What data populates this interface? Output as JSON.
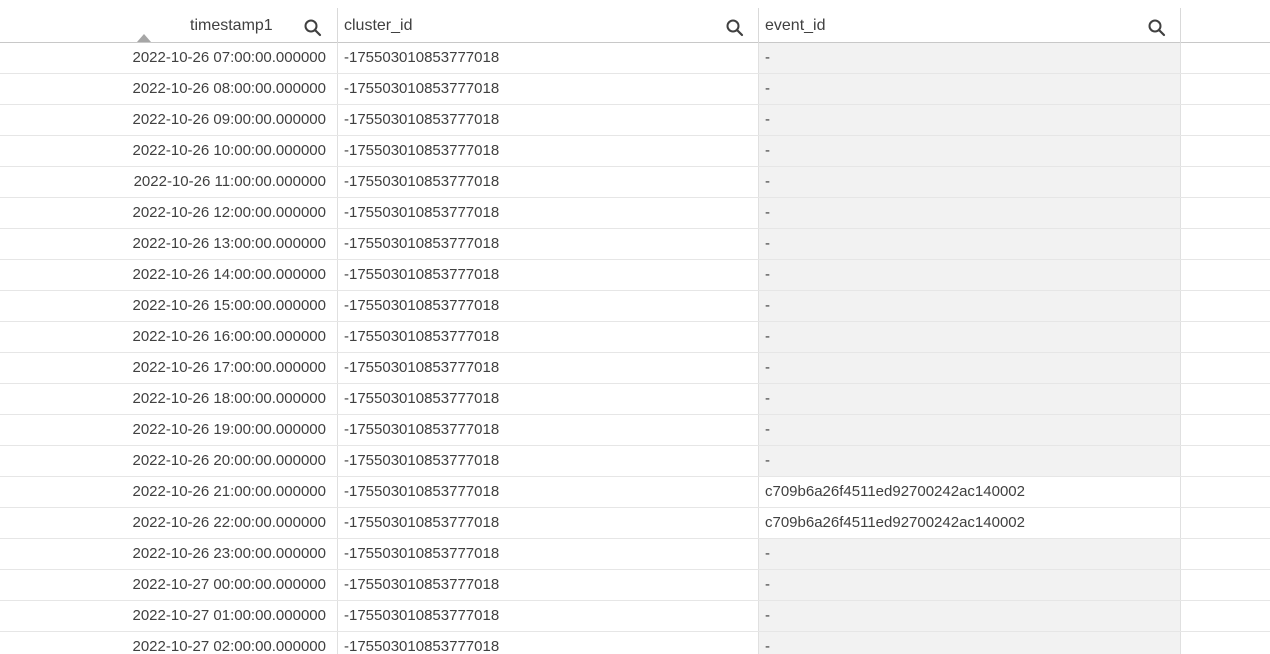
{
  "columns": [
    {
      "key": "timestamp1",
      "label": "timestamp1",
      "sorted": "ascending"
    },
    {
      "key": "cluster_id",
      "label": "cluster_id"
    },
    {
      "key": "event_id",
      "label": "event_id"
    }
  ],
  "icons": {
    "column_search": "search-icon",
    "sort": "sort-ascending-icon"
  },
  "colors": {
    "null_cell_background": "#f2f2f2",
    "grid_line": "#e6e6e6",
    "text": "#404040"
  },
  "rows": [
    {
      "timestamp1": "2022-10-26 07:00:00.000000",
      "cluster_id": "-175503010853777018",
      "event_id": "-"
    },
    {
      "timestamp1": "2022-10-26 08:00:00.000000",
      "cluster_id": "-175503010853777018",
      "event_id": "-"
    },
    {
      "timestamp1": "2022-10-26 09:00:00.000000",
      "cluster_id": "-175503010853777018",
      "event_id": "-"
    },
    {
      "timestamp1": "2022-10-26 10:00:00.000000",
      "cluster_id": "-175503010853777018",
      "event_id": "-"
    },
    {
      "timestamp1": "2022-10-26 11:00:00.000000",
      "cluster_id": "-175503010853777018",
      "event_id": "-"
    },
    {
      "timestamp1": "2022-10-26 12:00:00.000000",
      "cluster_id": "-175503010853777018",
      "event_id": "-"
    },
    {
      "timestamp1": "2022-10-26 13:00:00.000000",
      "cluster_id": "-175503010853777018",
      "event_id": "-"
    },
    {
      "timestamp1": "2022-10-26 14:00:00.000000",
      "cluster_id": "-175503010853777018",
      "event_id": "-"
    },
    {
      "timestamp1": "2022-10-26 15:00:00.000000",
      "cluster_id": "-175503010853777018",
      "event_id": "-"
    },
    {
      "timestamp1": "2022-10-26 16:00:00.000000",
      "cluster_id": "-175503010853777018",
      "event_id": "-"
    },
    {
      "timestamp1": "2022-10-26 17:00:00.000000",
      "cluster_id": "-175503010853777018",
      "event_id": "-"
    },
    {
      "timestamp1": "2022-10-26 18:00:00.000000",
      "cluster_id": "-175503010853777018",
      "event_id": "-"
    },
    {
      "timestamp1": "2022-10-26 19:00:00.000000",
      "cluster_id": "-175503010853777018",
      "event_id": "-"
    },
    {
      "timestamp1": "2022-10-26 20:00:00.000000",
      "cluster_id": "-175503010853777018",
      "event_id": "-"
    },
    {
      "timestamp1": "2022-10-26 21:00:00.000000",
      "cluster_id": "-175503010853777018",
      "event_id": "c709b6a26f4511ed92700242ac140002"
    },
    {
      "timestamp1": "2022-10-26 22:00:00.000000",
      "cluster_id": "-175503010853777018",
      "event_id": "c709b6a26f4511ed92700242ac140002"
    },
    {
      "timestamp1": "2022-10-26 23:00:00.000000",
      "cluster_id": "-175503010853777018",
      "event_id": "-"
    },
    {
      "timestamp1": "2022-10-27 00:00:00.000000",
      "cluster_id": "-175503010853777018",
      "event_id": "-"
    },
    {
      "timestamp1": "2022-10-27 01:00:00.000000",
      "cluster_id": "-175503010853777018",
      "event_id": "-"
    },
    {
      "timestamp1": "2022-10-27 02:00:00.000000",
      "cluster_id": "-175503010853777018",
      "event_id": "-"
    }
  ]
}
